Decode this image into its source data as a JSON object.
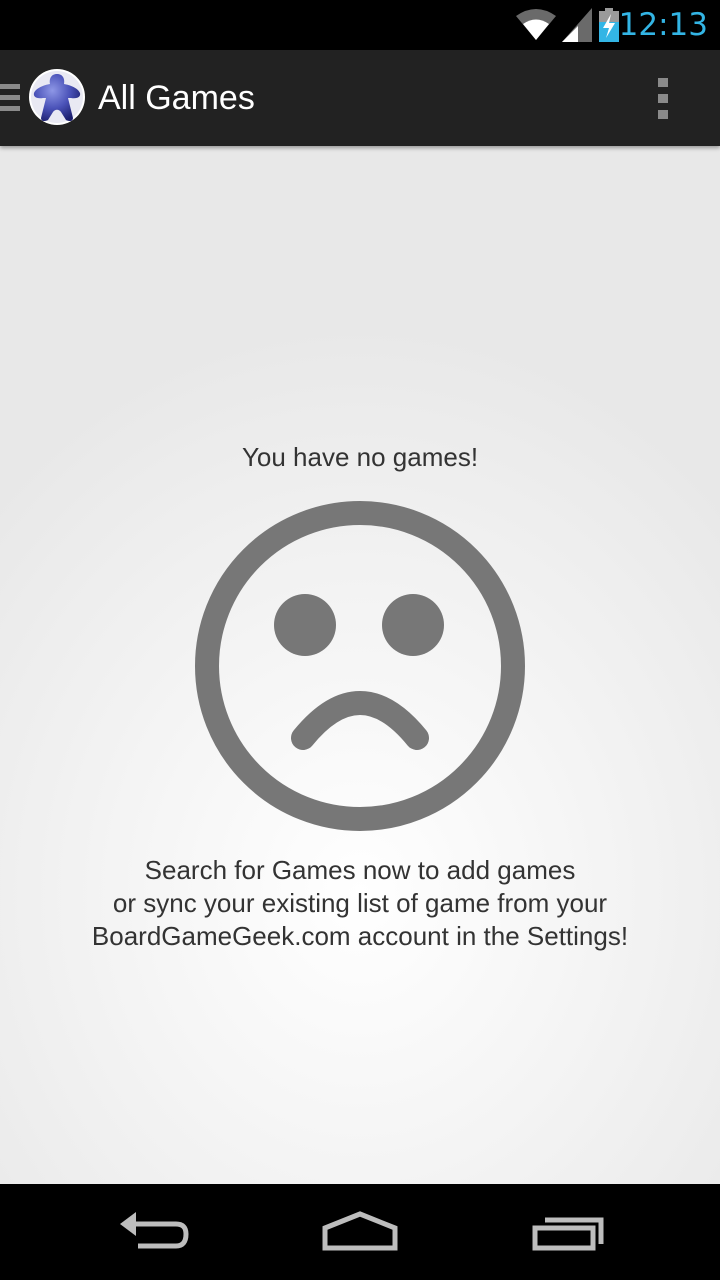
{
  "status_bar": {
    "time": "12:13",
    "icons": [
      "wifi-icon",
      "cell-signal-icon",
      "battery-charging-icon"
    ],
    "clock_color": "#33b5e5"
  },
  "action_bar": {
    "title": "All Games",
    "icons": [
      "drawer-menu-icon",
      "meeple-logo-icon",
      "overflow-menu-icon"
    ]
  },
  "empty_state": {
    "title": "You have no games!",
    "icon": "sad-face-icon",
    "message_lines": [
      "Search for Games now to add games",
      "or sync your existing list of game from your",
      "BoardGameGeek.com account in the Settings!"
    ]
  },
  "nav_bar": {
    "icons": [
      "back-icon",
      "home-icon",
      "recents-icon"
    ]
  }
}
